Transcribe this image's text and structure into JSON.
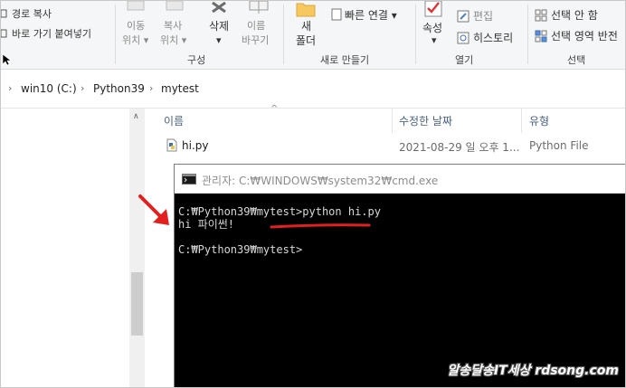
{
  "ribbon": {
    "clipboard": {
      "copy_path": "경로 복사",
      "paste_shortcut": "바로 가기 붙여넣기"
    },
    "organize": {
      "move_to": [
        "이동",
        "위치 ▾"
      ],
      "copy_to": [
        "복사",
        "위치 ▾"
      ],
      "delete": [
        "삭제",
        "▾"
      ],
      "rename": [
        "이름",
        "바꾸기"
      ],
      "label": "구성"
    },
    "new": {
      "new_folder": [
        "새",
        "폴더"
      ],
      "easy_access": "빠른 연결 ▾",
      "label": "새로 만들기"
    },
    "open": {
      "properties": [
        "속성",
        "▾"
      ],
      "edit": "편집",
      "history": "히스토리",
      "label": "열기"
    },
    "select": {
      "select_none": "선택 안 함",
      "invert_selection": "선택 영역 반전",
      "label": "선택"
    }
  },
  "address": {
    "root_chevron": "›",
    "path": [
      "win10 (C:)",
      "Python39",
      "mytest"
    ],
    "separator": "›"
  },
  "file_list": {
    "columns": {
      "name": "이름",
      "modified": "수정한 날짜",
      "type": "유형"
    },
    "rows": [
      {
        "name": "hi.py",
        "modified": "2021-08-29 일 오후 1...",
        "type": "Python File"
      }
    ]
  },
  "cmd": {
    "title": "관리자: C:₩WINDOWS₩system32₩cmd.exe",
    "lines": [
      "C:₩Python39₩mytest>python hi.py",
      "hi 파이썬!",
      "",
      "C:₩Python39₩mytest>"
    ]
  },
  "watermark": "알송달송IT세상 rdsong.com",
  "colors": {
    "annotation_red": "#e32020",
    "column_header": "#4a6183",
    "cmd_bg": "#000000"
  }
}
